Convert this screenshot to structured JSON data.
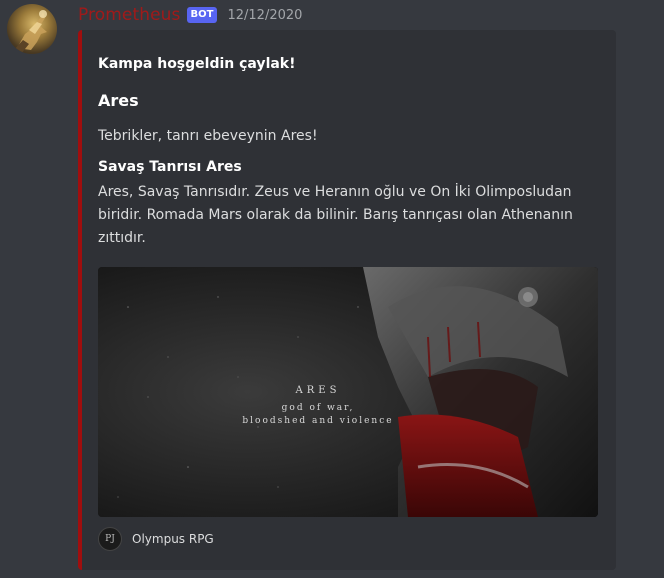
{
  "message": {
    "username": "Prometheus",
    "bot_tag": "BOT",
    "timestamp": "12/12/2020",
    "colors": {
      "username": "#a01a1a",
      "embed_border": "#a00e0e",
      "bot_tag": "#5865f2",
      "background": "#36393f",
      "embed_background": "#2f3136"
    }
  },
  "embed": {
    "author": "Kampa hoşgeldin çaylak!",
    "title": "Ares",
    "description": "Tebrikler, tanrı ebeveynin Ares!",
    "field": {
      "name": "Savaş Tanrısı Ares",
      "value": "Ares, Savaş Tanrısıdır. Zeus ve Heranın oğlu ve On İki Olimposludan biridir. Romada Mars olarak da bilinir. Barış tanrıçası olan Athenanın zıttıdır."
    },
    "image": {
      "title": "ARES",
      "subtitle_line1": "god of war,",
      "subtitle_line2": "bloodshed and violence"
    },
    "footer": {
      "icon_text": "PJ",
      "text": "Olympus RPG"
    }
  },
  "icons": {
    "avatar": "prometheus-avatar",
    "footer": "olympus-rpg-icon"
  }
}
